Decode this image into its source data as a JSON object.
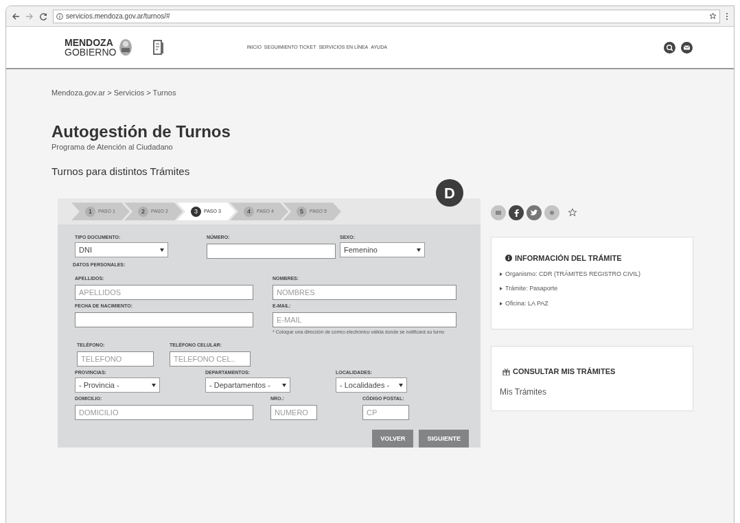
{
  "browser": {
    "url": "servicios.mendoza.gov.ar/turnos/#"
  },
  "header": {
    "logo_top": "MENDOZA",
    "logo_bottom": "GOBIERNO",
    "nav": [
      "INICIO",
      "SEGUIMIENTO TICKET",
      "SERVICIOS EN LÍNEA",
      "AYUDA"
    ]
  },
  "breadcrumb": [
    "Mendoza.gov.ar",
    "Servicios",
    "Turnos"
  ],
  "breadcrumb_separator": ">",
  "title": "Autogestión de Turnos",
  "subtitle": "Programa de Atención al Ciudadano",
  "section_title": "Turnos para distintos Trámites",
  "badge": "D",
  "steps": [
    {
      "number": "1",
      "label": "PASO 1",
      "selected": false
    },
    {
      "number": "2",
      "label": "PASO 2",
      "selected": false
    },
    {
      "number": "3",
      "label": "PASO 3",
      "selected": true
    },
    {
      "number": "4",
      "label": "PASO 4",
      "selected": false
    },
    {
      "number": "5",
      "label": "PASO 5",
      "selected": false
    }
  ],
  "form_rows": [
    {
      "fields": [
        {
          "kind": "select",
          "label": "TIPO DOCUMENTO:",
          "value": "DNI"
        },
        {
          "kind": "input",
          "label": "NÚMERO:"
        },
        {
          "kind": "select",
          "label": "SEXO:",
          "value": "Femenino"
        }
      ]
    },
    {
      "heading": "DATOS PERSONALES:"
    },
    {
      "fields": [
        {
          "kind": "input",
          "label": "APELLIDOS:",
          "placeholder": "APELLIDOS"
        },
        {
          "kind": "input",
          "label": "NOMBRES:",
          "placeholder": "NOMBRES"
        }
      ]
    },
    {
      "fields": [
        {
          "kind": "input",
          "label": "FECHA DE NACIMIENTO:"
        },
        {
          "kind": "input",
          "label": "E-MAIL:",
          "placeholder": "E-MAIL",
          "note": "* Coloque una dirección de correo electrónico válida donde se notificará su turno"
        }
      ]
    },
    {
      "fields": [
        {
          "kind": "input",
          "label": "TELÉFONO:",
          "placeholder": "TELEFONO"
        },
        {
          "kind": "input",
          "label": "TELÉFONO CELULAR:",
          "placeholder": "TELEFONO CEL.."
        }
      ]
    },
    {
      "fields": [
        {
          "kind": "select",
          "label": "PROVINCIAS:",
          "value": "- Provincia -"
        },
        {
          "kind": "select",
          "label": "DEPARTAMENTOS:",
          "value": "- Departamentos -"
        },
        {
          "kind": "select",
          "label": "LOCALIDADES:",
          "value": "- Localidades -"
        }
      ]
    },
    {
      "fields": [
        {
          "kind": "input",
          "label": "DOMICILIO:",
          "placeholder": "DOMICILIO"
        },
        {
          "kind": "input",
          "label": "NRO.:",
          "placeholder": "NUMERO"
        },
        {
          "kind": "input",
          "label": "CÓDIGO POSTAL:",
          "placeholder": "CP"
        }
      ]
    }
  ],
  "buttons": [
    "VOLVER",
    "SIGUIENTE"
  ],
  "info_card": {
    "title": "INFORMACIÓN DEL TRÁMITE",
    "items": [
      "Organismo: CDR (TRÁMITES REGISTRO CIVIL)",
      "Trámite: Pasaporte",
      "Oficina: LA PAZ"
    ]
  },
  "consult_card": {
    "title": "CONSULTAR MIS TRÁMITES",
    "link": "Mis Trámites"
  }
}
